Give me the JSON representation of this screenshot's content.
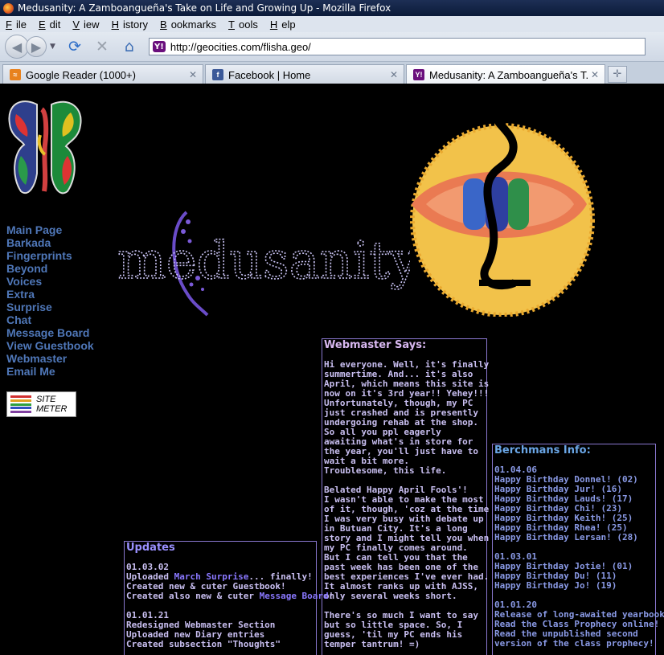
{
  "window": {
    "title": "Medusanity: A Zamboangueña's Take on Life and Growing Up - Mozilla Firefox"
  },
  "menu": [
    {
      "label": "File",
      "key": "F",
      "rest": "ile"
    },
    {
      "label": "Edit",
      "key": "E",
      "rest": "dit"
    },
    {
      "label": "View",
      "key": "V",
      "rest": "iew"
    },
    {
      "label": "History",
      "key": "H",
      "rest": "istory"
    },
    {
      "label": "Bookmarks",
      "key": "B",
      "rest": "ookmarks"
    },
    {
      "label": "Tools",
      "key": "T",
      "rest": "ools"
    },
    {
      "label": "Help",
      "key": "H",
      "rest": "elp"
    }
  ],
  "navbar": {
    "url": "http://geocities.com/flisha.geo/"
  },
  "tabs": [
    {
      "label": "Google Reader (1000+)",
      "icon": "rss-icon",
      "color": "#e8821e",
      "active": false
    },
    {
      "label": "Facebook | Home",
      "icon": "facebook-icon",
      "color": "#3b5998",
      "active": false
    },
    {
      "label": "Medusanity: A Zamboangueña's T...",
      "icon": "yahoo-icon",
      "color": "#6a0f7d",
      "active": true
    }
  ],
  "sidebar": {
    "links": [
      "Main Page",
      "Barkada",
      "Fingerprints",
      "Beyond",
      "Voices",
      "Extra",
      "Surprise",
      "Chat",
      "Message Board",
      "View Guestbook",
      "Webmaster",
      "Email Me"
    ],
    "sitemeter": {
      "line1": "SITE",
      "line2": "METER"
    }
  },
  "logo_text": "medusanity",
  "webmaster": {
    "title": "Webmaster Says:",
    "p1": [
      "Hi everyone. Well, it's finally",
      "summertime. And... it's also",
      "April, which means this site is",
      "now on it's 3rd year!! Yehey!!!",
      "Unfortunately, though, my PC",
      "just crashed and is presently",
      "undergoing rehab at the shop.",
      "So all you ppl eagerly",
      "awaiting what's in store for",
      "the year, you'll just have to",
      "wait a bit more.",
      "Troublesome, this life."
    ],
    "p2": [
      "Belated Happy April Fools'!",
      "I wasn't able to make the most",
      "of it, though, 'coz at the time",
      "I was very busy with debate up",
      "in Butuan City. It's a long",
      "story and I might tell you when",
      "my PC finally comes around.",
      "But I can tell you that the",
      "past week has been one of the",
      "best experiences I've ever had.",
      "It almost ranks up with AJSS,",
      "only several weeks short."
    ],
    "p3": [
      "There's so much I want to say",
      "but so little space. So, I",
      "guess, 'til my PC ends his",
      "temper tantrum! =)"
    ]
  },
  "updates": {
    "title": "Updates",
    "date1": "01.03.02",
    "l1a": "Uploaded ",
    "l1link": "March Surprise",
    "l1b": "... finally!",
    "l2": "Created new & cuter Guestbook!",
    "l3a": "Created also new & cuter ",
    "l3link": "Message Board",
    "l3b": "!",
    "date2": "01.01.21",
    "l4": "Redesigned Webmaster Section",
    "l5": "Uploaded new Diary entries",
    "l6": "Created subsection \"Thoughts\""
  },
  "berchmans": {
    "title": "Berchmans Info:",
    "g1": [
      "01.04.06",
      "Happy Birthday Donnel! (02)",
      "Happy Birthday Jur! (16)",
      "Happy Birthday Lauds! (17)",
      "Happy Birthday Chi! (23)",
      "Happy Birthday Keith! (25)",
      "Happy Birthday Rhea! (25)",
      "Happy Birthday Lersan! (28)"
    ],
    "g2": [
      "01.03.01",
      "Happy Birthday Jotie! (01)",
      "Happy Birthday Du! (11)",
      "Happy Birthday Jo! (19)"
    ],
    "g3": [
      "01.01.20",
      "Release of long-awaited yearbook!",
      "Read the Class Prophecy online!",
      "Read the unpublished second",
      "version of the class prophecy!"
    ]
  }
}
